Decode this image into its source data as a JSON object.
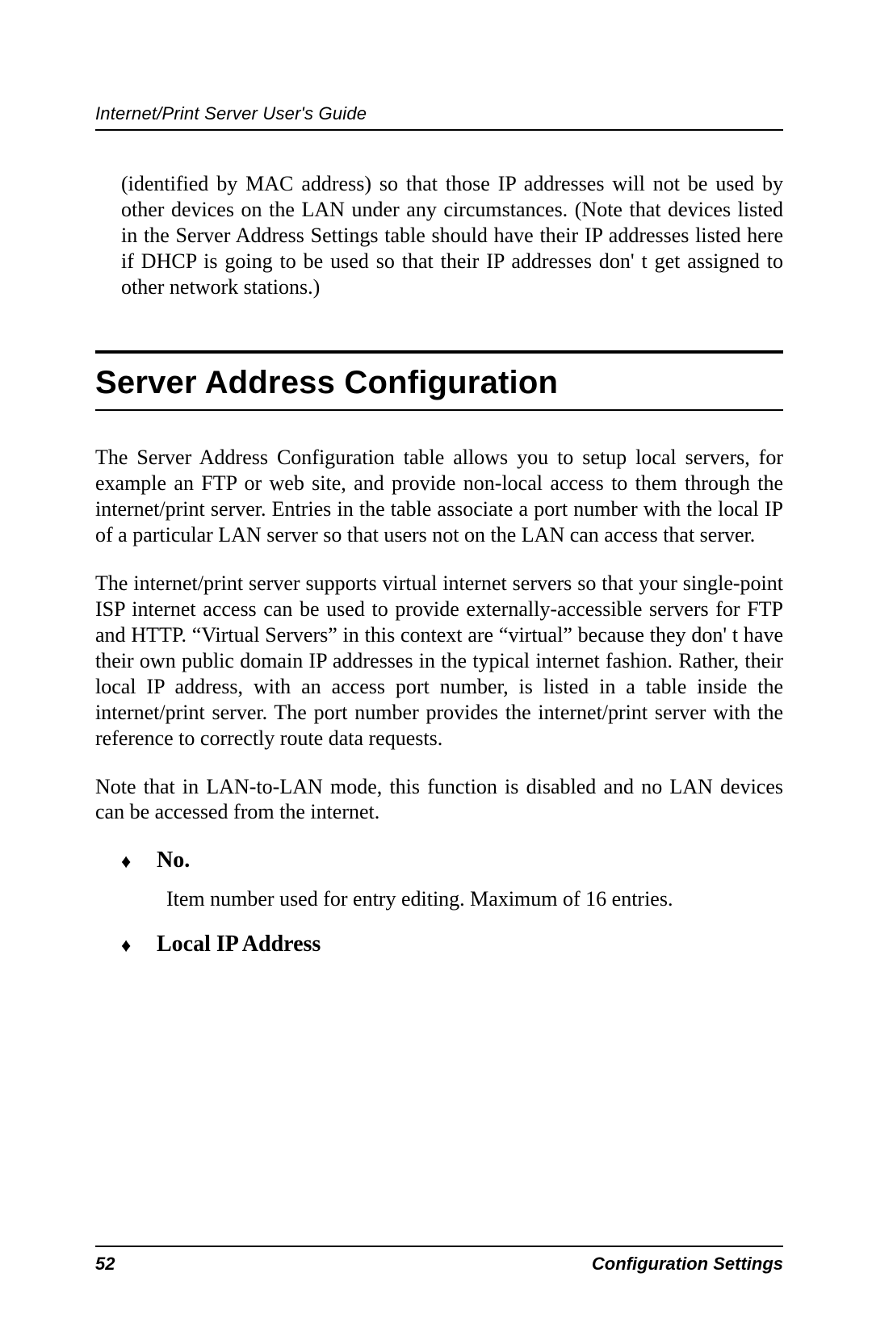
{
  "header": {
    "running_title": "Internet/Print Server User's Guide"
  },
  "continuation_para": "(identified by MAC address) so that those IP addresses will not be used by other devices on the LAN under any circumstances. (Note that devices listed in the Server Address Settings table should have their IP addresses listed here if DHCP is going to be used so that their IP addresses don' t get assigned to other network stations.)",
  "section": {
    "title": "Server Address Configuration",
    "paras": [
      "The Server Address Configuration table allows you to setup local servers, for example an FTP or web site, and provide non-local access to them through the internet/print server.  Entries in the table associate a port number with the local IP of a particular LAN server so that users not on the LAN can access that server.",
      "The internet/print server supports virtual internet servers so that your single-point ISP internet access can be used to provide externally-accessible servers for FTP and HTTP.  “Virtual Servers” in this context are “virtual” because they don' t have their own public domain IP addresses in the typical internet fashion.  Rather, their local IP address, with an access port number, is listed in a table inside the internet/print server.  The port number provides the internet/print server with the reference to correctly route data requests.",
      "Note that in LAN-to-LAN mode, this function is disabled and no LAN devices can be accessed from the internet."
    ],
    "bullets": [
      {
        "label": "No.",
        "desc": "Item number used for entry editing.  Maximum of 16 entries."
      },
      {
        "label": "Local IP Address",
        "desc": ""
      }
    ]
  },
  "footer": {
    "page_number": "52",
    "section_name": "Configuration Settings"
  }
}
